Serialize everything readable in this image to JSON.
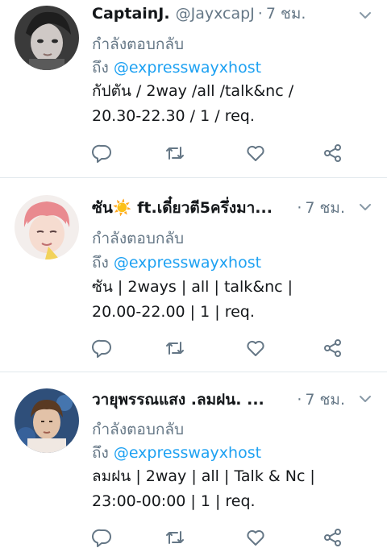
{
  "tweets": [
    {
      "name": "CaptainJ.",
      "handle": "@JayxcapJ",
      "separator": "·",
      "time": "7 ชม.",
      "reply_label": "กำลังตอบกลับ",
      "reply_prefix": "ถึง",
      "reply_mention": "@expresswayxhost",
      "text_line1": "กัปตัน / 2way /all /talk&nc /",
      "text_line2": "20.30-22.30 / 1 / req."
    },
    {
      "name": "ซัน☀️ ft.เดี๋ยวตี5ครึ่งมา...",
      "handle": "",
      "separator": "·",
      "time": "7 ชม.",
      "reply_label": "กำลังตอบกลับ",
      "reply_prefix": "ถึง",
      "reply_mention": "@expresswayxhost",
      "text_line1": "ซัน | 2ways | all | talk&nc |",
      "text_line2": "20.00-22.00 | 1 | req."
    },
    {
      "name": "วายุพรรณแสง .ลมฝน. ...",
      "handle": "",
      "separator": "·",
      "time": "7 ชม.",
      "reply_label": "กำลังตอบกลับ",
      "reply_prefix": "ถึง",
      "reply_mention": "@expresswayxhost",
      "text_line1": "ลมฝน | 2way | all | Talk & Nc |",
      "text_line2": "23:00-00:00 | 1 | req."
    }
  ],
  "icons": {
    "reply": "reply-icon",
    "retweet": "retweet-icon",
    "like": "heart-icon",
    "share": "share-icon",
    "menu": "chevron-down-icon"
  },
  "colors": {
    "text": "#14171a",
    "secondary": "#657786",
    "link": "#1da1f2",
    "divider": "#e1e8ed"
  }
}
